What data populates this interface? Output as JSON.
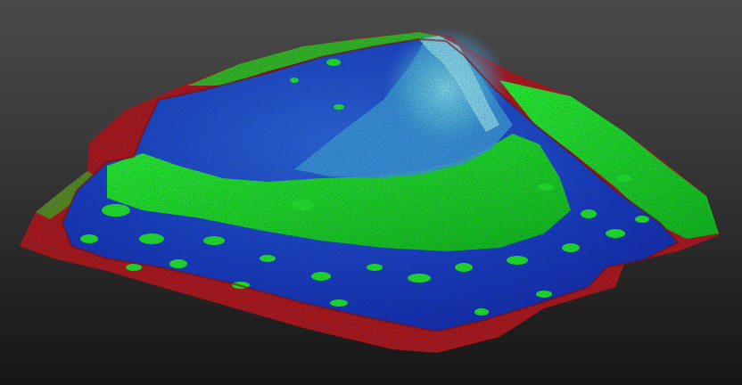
{
  "viewer": {
    "background_top": "#4a4a4a",
    "background_bottom": "#161616"
  },
  "scalar_colors": {
    "low": "#c01010",
    "mid": "#19ee19",
    "high": "#1832c8",
    "peak": "#5cc8e6"
  }
}
